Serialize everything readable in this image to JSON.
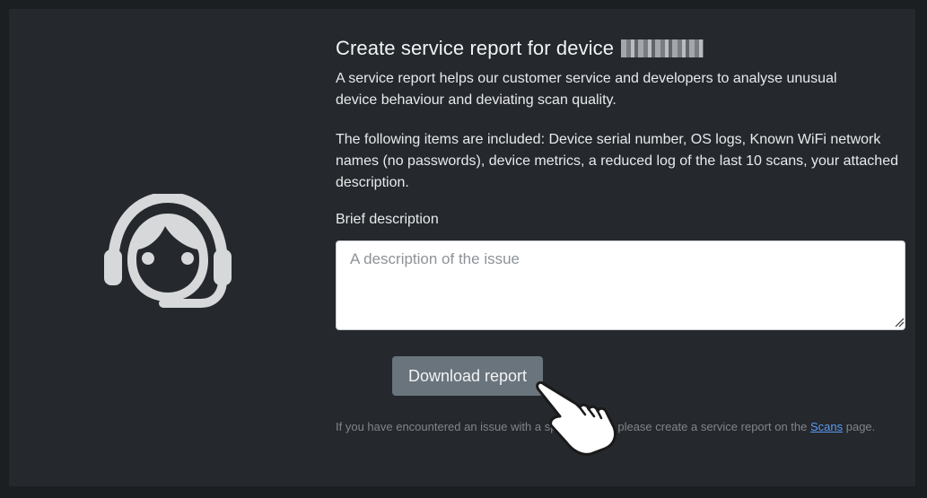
{
  "header": {
    "title": "Create service report for device",
    "device_id_redacted": "redacted"
  },
  "intro": {
    "paragraph1": "A service report helps our customer service and developers to analyse unusual device behaviour and deviating scan quality.",
    "paragraph2": "The following items are included: Device serial number, OS logs, Known WiFi network names (no passwords), device metrics, a reduced log of the last 10 scans, your attached description."
  },
  "form": {
    "description_label": "Brief description",
    "description_placeholder": "A description of the issue",
    "description_value": ""
  },
  "actions": {
    "download_label": "Download report"
  },
  "hint": {
    "prefix": "If you have encountered an issue with a specific scan, please create a service report on the ",
    "link_label": "Scans",
    "suffix": " page."
  },
  "icons": {
    "support": "customer-support-headset-icon",
    "pointer": "hand-pointer-cursor-icon"
  },
  "colors": {
    "background": "#1c1f22",
    "card": "#25282c",
    "button": "#6a747d",
    "link": "#5a9bf5"
  }
}
